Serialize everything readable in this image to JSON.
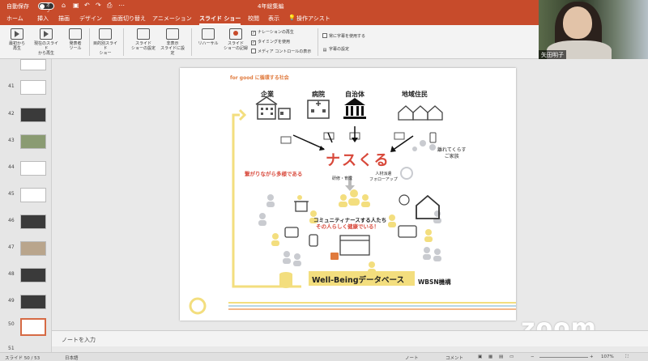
{
  "titlebar": {
    "autosave": "自動保存",
    "toggle": "オフ",
    "doc": "4年総集編"
  },
  "tabs": [
    "ホーム",
    "挿入",
    "描画",
    "デザイン",
    "画面切り替え",
    "アニメーション",
    "スライド ショー",
    "校閲",
    "表示",
    "操作アシスト"
  ],
  "active_tab": "スライド ショー",
  "ribbon": {
    "buttons": [
      "最初から\n再生",
      "現在のスライド\nから再生",
      "発表者\nツール",
      "目的別スライド\nショー",
      "スライド\nショーの設定",
      "非表示\nスライドに設定",
      "リハーサル",
      "スライド\nショーの記録"
    ],
    "checks": [
      "ナレーションの再生",
      "タイミングを使用",
      "メディア コントロールの表示"
    ],
    "checks_right": [
      "常に字幕を使用する",
      "字幕の設定"
    ]
  },
  "video": {
    "name": "矢田明子"
  },
  "thumbnails": {
    "numbers": [
      "41",
      "42",
      "43",
      "44",
      "45",
      "46",
      "47",
      "48",
      "49",
      "50",
      "51"
    ],
    "selected": "50"
  },
  "slide": {
    "header": "for good に循環する社会",
    "sectors": [
      "企業",
      "病院",
      "自治体",
      "地域住民"
    ],
    "logo_main": "ナスくる",
    "sub1": "研修・育成",
    "sub2": "人材派遣\nフォローアップ",
    "left_note": "繋がりながら多様である",
    "family": "離れてくらす\nご家族",
    "community1": "コミュニティナースする人たち",
    "community2": "その人らしく健康でいる！",
    "database": "Well-Beingデータベース",
    "org": "WBSN機構"
  },
  "notes": "ノートを入力",
  "status": {
    "slide": "スライド 50 / 53",
    "lang": "日本語",
    "notes": "ノート",
    "comments": "コメント",
    "zoom": "107%"
  },
  "colors": {
    "accent": "#c74b2b",
    "orange": "#e07a3d",
    "yellow": "#f3de7e",
    "gray": "#c9cbd0"
  },
  "overlay": "zoom"
}
